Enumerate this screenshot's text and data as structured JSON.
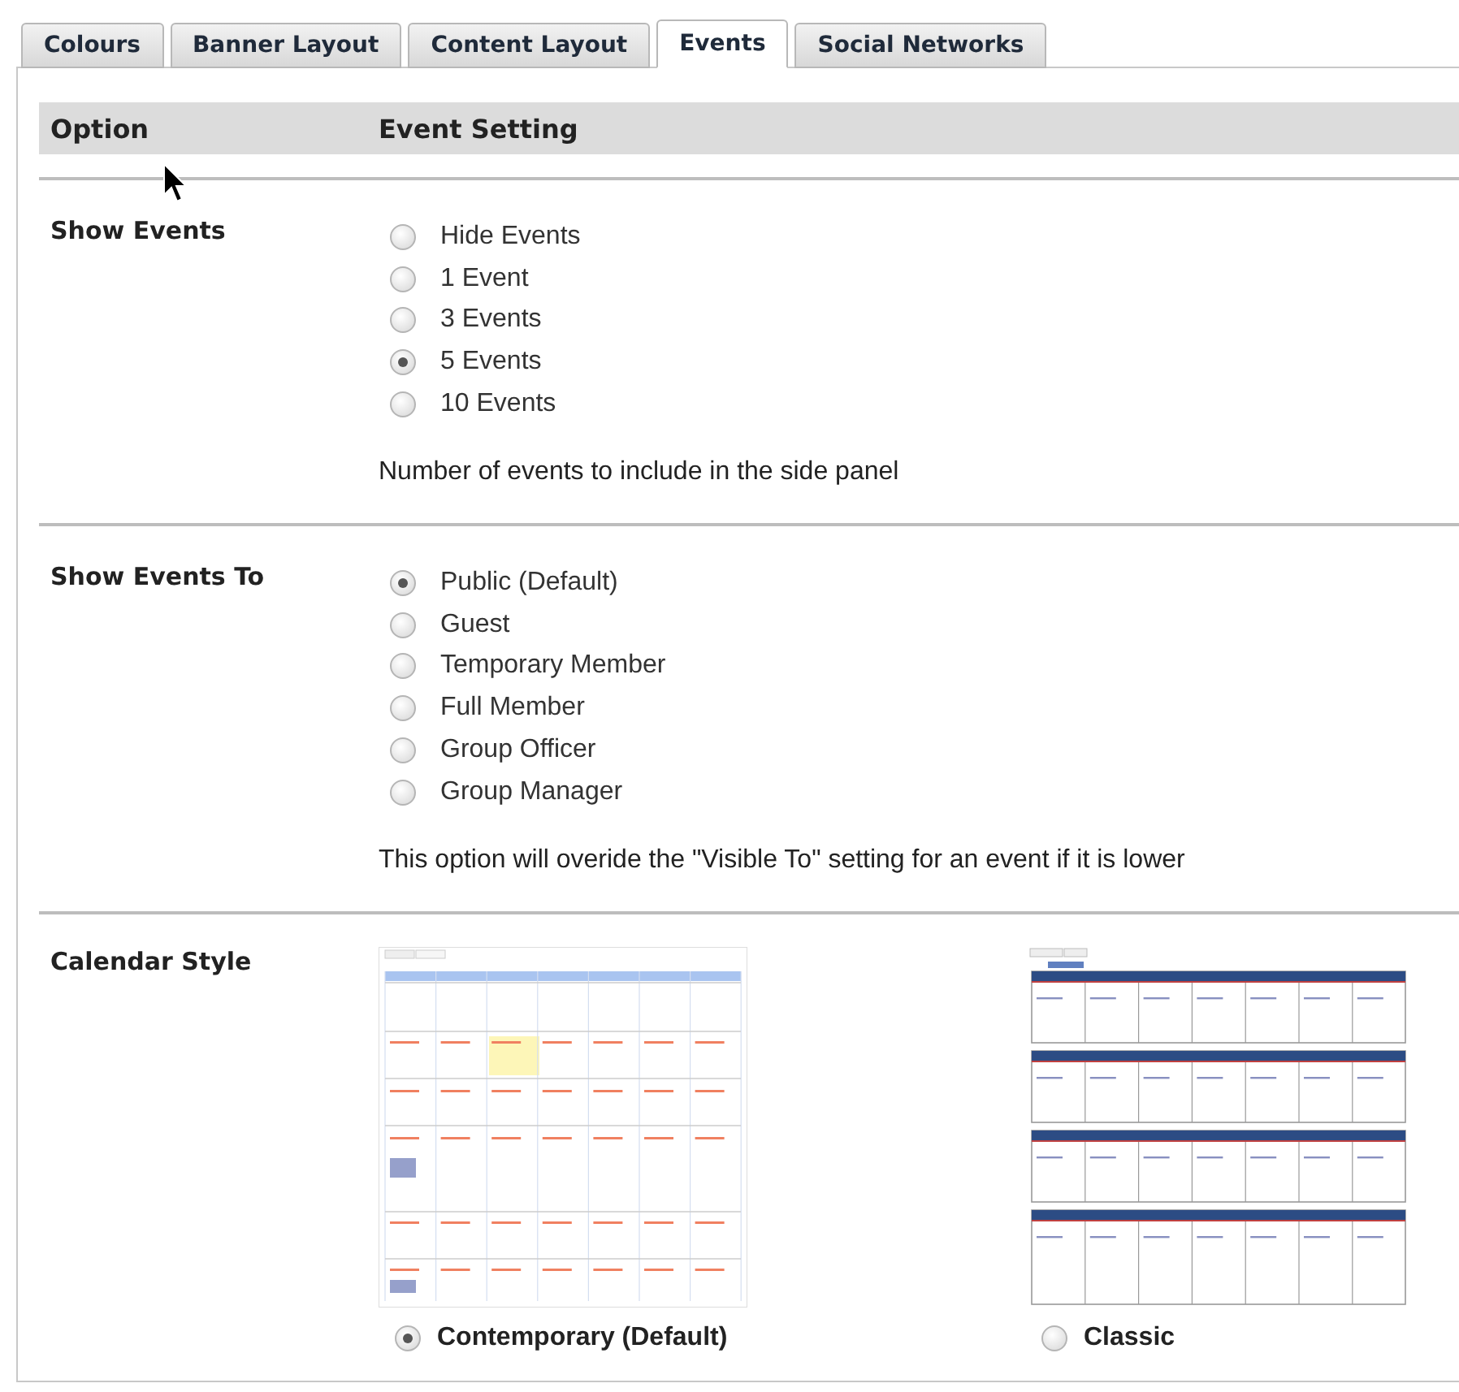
{
  "tabs": [
    {
      "label": "Colours",
      "selected": false
    },
    {
      "label": "Banner Layout",
      "selected": false
    },
    {
      "label": "Content Layout",
      "selected": false
    },
    {
      "label": "Events",
      "selected": true
    },
    {
      "label": "Social Networks",
      "selected": false
    }
  ],
  "table": {
    "columns": [
      "Option",
      "Event Setting"
    ],
    "rows": [
      {
        "kind": "radio",
        "label": "Show Events",
        "options": [
          {
            "label": "Hide Events",
            "selected": false
          },
          {
            "label": "1 Event",
            "selected": false
          },
          {
            "label": "3 Events",
            "selected": false
          },
          {
            "label": "5 Events",
            "selected": true
          },
          {
            "label": "10 Events",
            "selected": false
          }
        ],
        "help": "Number of events to include in the side panel"
      },
      {
        "kind": "radio",
        "label": "Show Events To",
        "options": [
          {
            "label": "Public (Default)",
            "selected": true
          },
          {
            "label": "Guest",
            "selected": false
          },
          {
            "label": "Temporary Member",
            "selected": false
          },
          {
            "label": "Full Member",
            "selected": false
          },
          {
            "label": "Group Officer",
            "selected": false
          },
          {
            "label": "Group Manager",
            "selected": false
          }
        ],
        "help": "This option will overide the \"Visible To\" setting for an event if it is lower"
      },
      {
        "kind": "image-choice",
        "label": "Calendar Style",
        "options": [
          {
            "label": "Contemporary (Default)",
            "selected": true,
            "kind": "contemporary"
          },
          {
            "label": "Classic",
            "selected": false,
            "kind": "classic"
          }
        ]
      }
    ]
  }
}
